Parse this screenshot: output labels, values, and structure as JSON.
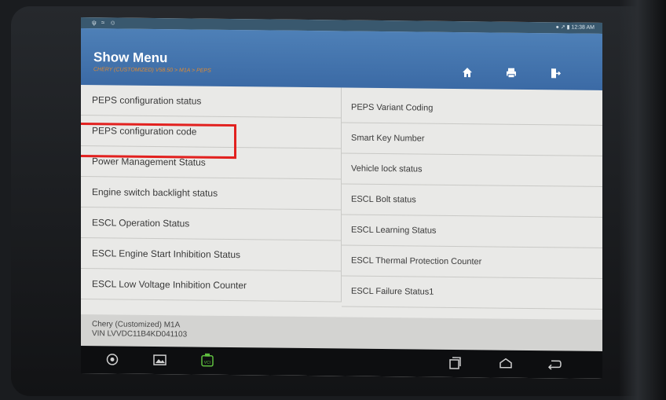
{
  "status": {
    "icons": "ψ ≈ ☺",
    "time": "● ↗  ▮ 12:38 AM"
  },
  "header": {
    "title": "Show Menu",
    "breadcrumb": "CHERY (CUSTOMIZED) V58.50 > M1A > PEPS"
  },
  "toolbar": {
    "home": "home-icon",
    "print": "print-icon",
    "exit": "exit-icon"
  },
  "menu": {
    "left": [
      "PEPS configuration status",
      "PEPS configuration code",
      "Power Management Status",
      "Engine switch backlight status",
      "ESCL Operation Status",
      "ESCL Engine Start Inhibition Status",
      "ESCL Low Voltage Inhibition Counter"
    ],
    "right": [
      "PEPS Variant Coding",
      "Smart Key Number",
      "Vehicle lock status",
      "ESCL Bolt status",
      "ESCL Learning Status",
      "ESCL Thermal Protection Counter",
      "ESCL Failure Status1"
    ]
  },
  "vehicle": {
    "model": "Chery (Customized) M1A",
    "vin": "VIN LVVDC11B4KD041103"
  },
  "navbar": {
    "vci": "VCI"
  },
  "colors": {
    "header": "#3b6aa5",
    "highlight": "#e2211f",
    "breadcrumb": "#e08a30"
  }
}
